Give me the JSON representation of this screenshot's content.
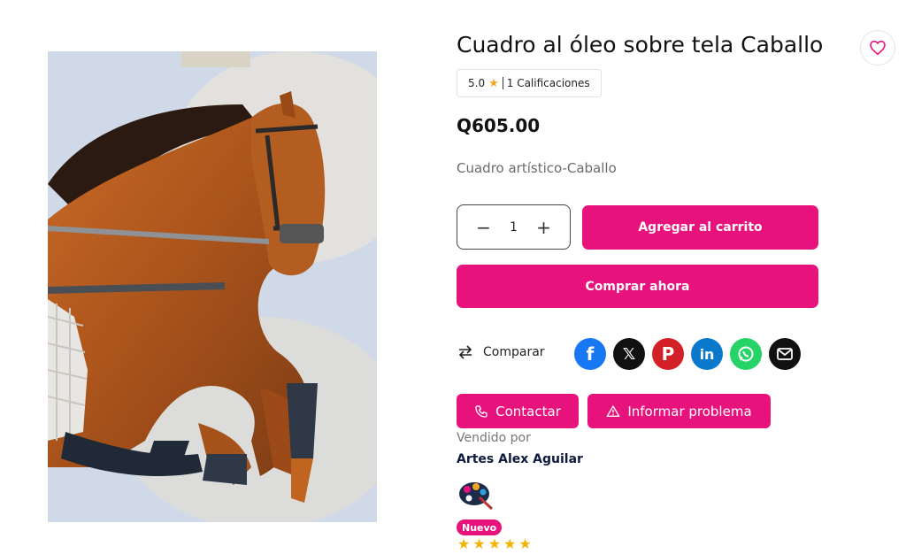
{
  "product": {
    "title": "Cuadro al óleo sobre tela Caballo",
    "rating_value": "5.0",
    "rating_count": "1 Calificaciones",
    "price": "Q605.00",
    "description": "Cuadro artístico-Caballo",
    "image_icon": "horse-painting"
  },
  "purchase": {
    "quantity": "1",
    "minus": "−",
    "plus": "+",
    "add_to_cart": "Agregar al carrito",
    "buy_now": "Comprar ahora"
  },
  "share": {
    "compare_label": "Comparar",
    "networks": [
      "facebook-icon",
      "x-icon",
      "pinterest-icon",
      "linkedin-icon",
      "whatsapp-icon",
      "email-icon"
    ]
  },
  "actions": {
    "contact": "Contactar",
    "report": "Informar problema"
  },
  "seller": {
    "sold_by_label": "Vendido por",
    "name": "Artes Alex Aguilar",
    "badge": "Nuevo",
    "stars": 5
  },
  "colors": {
    "accent": "#e8127c",
    "star": "#f5a623"
  }
}
